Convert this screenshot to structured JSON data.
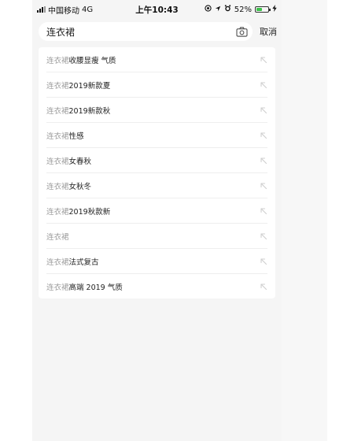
{
  "status_bar": {
    "carrier": "中国移动",
    "network": "4G",
    "time": "上午10:43",
    "battery_text": "52%",
    "battery_level": 0.52,
    "battery_color": "#3cc24a"
  },
  "search": {
    "query": "连衣裙",
    "cancel_label": "取消"
  },
  "suggestions": [
    {
      "keyword": "连衣裙",
      "rest": "收腰显瘦 气质"
    },
    {
      "keyword": "连衣裙",
      "rest": "2019新款夏"
    },
    {
      "keyword": "连衣裙",
      "rest": "2019新款秋"
    },
    {
      "keyword": "连衣裙",
      "rest": "性感"
    },
    {
      "keyword": "连衣裙",
      "rest": "女春秋"
    },
    {
      "keyword": "连衣裙",
      "rest": "女秋冬"
    },
    {
      "keyword": "连衣裙",
      "rest": "2019秋款新"
    },
    {
      "keyword": "连衣裙",
      "rest": ""
    },
    {
      "keyword": "连衣裙",
      "rest": "法式复古"
    },
    {
      "keyword": "连衣裙",
      "rest": "高端 2019 气质"
    }
  ]
}
